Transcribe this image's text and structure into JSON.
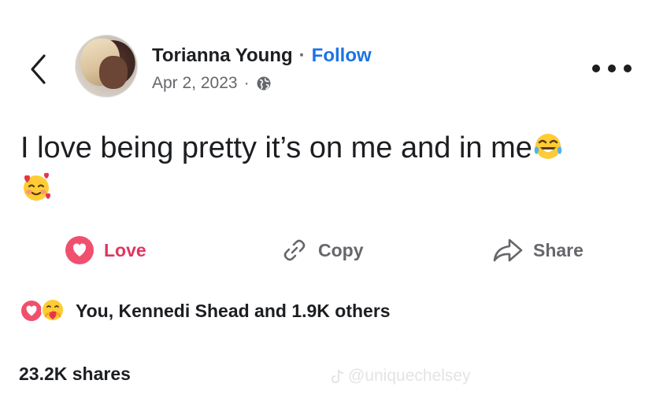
{
  "post": {
    "author": "Torianna Young",
    "separator": "·",
    "follow_label": "Follow",
    "date": "Apr 2, 2023",
    "date_separator": "·",
    "privacy_icon": "globe-icon",
    "text": "I love being pretty it’s on me and in me"
  },
  "actions": {
    "love_label": "Love",
    "copy_label": "Copy",
    "share_label": "Share"
  },
  "reactions": {
    "summary": "You, Kennedi Shead and 1.9K others",
    "icons": [
      "love-reaction-icon",
      "care-reaction-icon"
    ]
  },
  "shares": {
    "label": "23.2K shares"
  },
  "watermark": {
    "text": "@uniquechelsey"
  },
  "colors": {
    "accent_blue": "#1b74e4",
    "love_red": "#e0355e",
    "muted_text": "#65676b"
  }
}
